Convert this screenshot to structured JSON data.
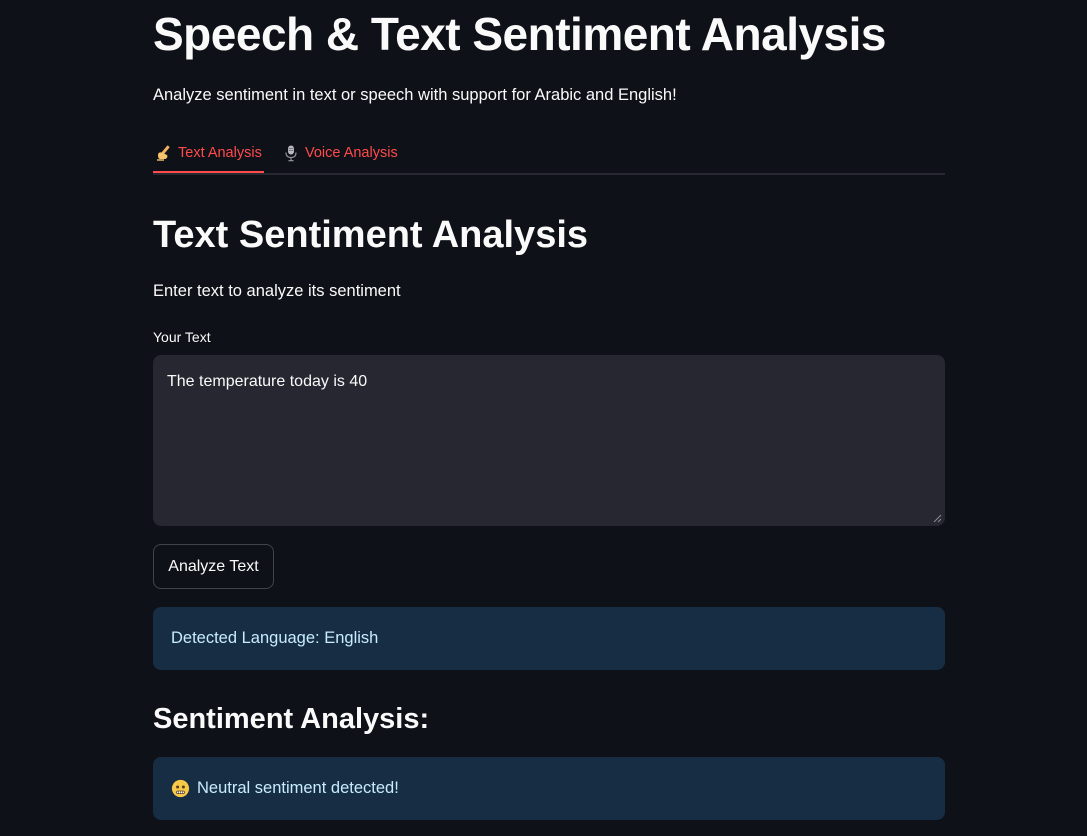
{
  "app": {
    "title": "Speech & Text Sentiment Analysis",
    "subtitle": "Analyze sentiment in text or speech with support for Arabic and English!"
  },
  "tabs": [
    {
      "label": "Text Analysis",
      "icon": "writing-hand-icon",
      "active": true
    },
    {
      "label": "Voice Analysis",
      "icon": "microphone-icon",
      "active": false
    }
  ],
  "text_section": {
    "title": "Text Sentiment Analysis",
    "description": "Enter text to analyze its sentiment",
    "input_label": "Your Text",
    "input_value": "The temperature today is 40",
    "analyze_button": "Analyze Text"
  },
  "detected_language": "Detected Language: English",
  "results": {
    "title": "Sentiment Analysis:",
    "message": "Neutral sentiment detected!",
    "icon": "neutral-face-icon"
  },
  "colors": {
    "background": "#0e1117",
    "accent": "#ff4b4b",
    "input_bg": "#262730",
    "info_bg": "#172d43",
    "info_text": "#c7ebff"
  }
}
